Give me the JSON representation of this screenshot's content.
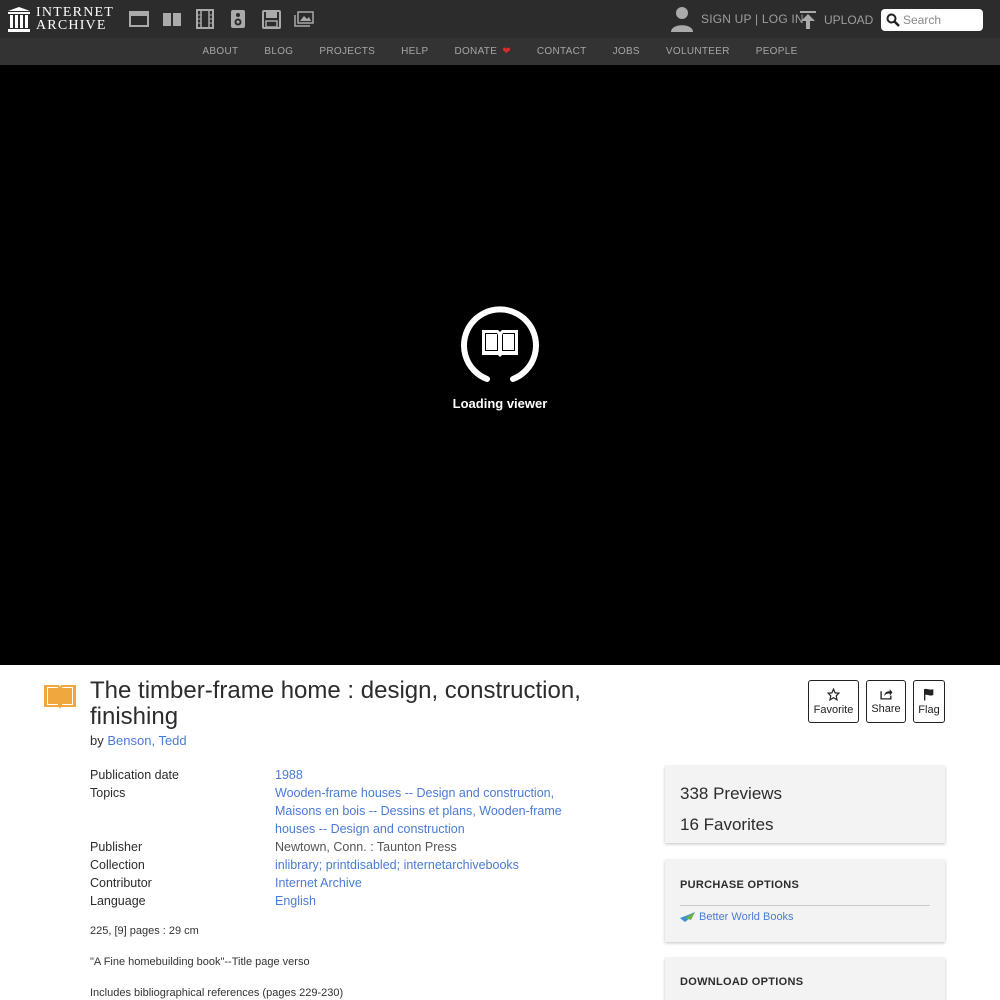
{
  "header": {
    "logo_line1": "INTERNET",
    "logo_line2": "ARCHIVE",
    "media_icons": [
      "web-icon",
      "texts-icon",
      "video-icon",
      "audio-icon",
      "software-icon",
      "images-icon"
    ],
    "auth_text": "SIGN UP | LOG IN",
    "upload_label": "UPLOAD",
    "search_placeholder": "Search"
  },
  "subnav": {
    "items": [
      "ABOUT",
      "BLOG",
      "PROJECTS",
      "HELP",
      "DONATE",
      "CONTACT",
      "JOBS",
      "VOLUNTEER",
      "PEOPLE"
    ]
  },
  "viewer": {
    "loading_text": "Loading viewer"
  },
  "item": {
    "title": "The timber-frame home : design, construction, finishing",
    "by_prefix": "by",
    "author": "Benson, Tedd",
    "actions": {
      "favorite": "Favorite",
      "share": "Share",
      "flag": "Flag"
    },
    "metadata": {
      "publication_date_label": "Publication date",
      "publication_date": "1988",
      "topics_label": "Topics",
      "topic_1": "Wooden-frame houses -- Design and construction",
      "topic_2": "Maisons en bois -- Dessins et plans",
      "topic_3": "Wooden-frame houses -- Design and construction",
      "publisher_label": "Publisher",
      "publisher": "Newtown, Conn. : Taunton Press",
      "collection_label": "Collection",
      "collection_1": "inlibrary",
      "collection_2": "printdisabled",
      "collection_3": "internetarchivebooks",
      "contributor_label": "Contributor",
      "contributor": "Internet Archive",
      "language_label": "Language",
      "language": "English"
    },
    "description": [
      "225, [9] pages : 29 cm",
      "\"A Fine homebuilding book\"--Title page verso",
      "Includes bibliographical references (pages 229-230)"
    ]
  },
  "sidebar": {
    "previews": "338 Previews",
    "favorites": "16 Favorites",
    "purchase_heading": "PURCHASE OPTIONS",
    "better_world_books": "Better World Books",
    "download_heading": "DOWNLOAD OPTIONS"
  },
  "colors": {
    "topbar": "#2c2c2c",
    "subnav": "#333333",
    "link": "#4b7bd6",
    "heart": "#e02a2a",
    "texts_icon": "#f0a73d"
  }
}
